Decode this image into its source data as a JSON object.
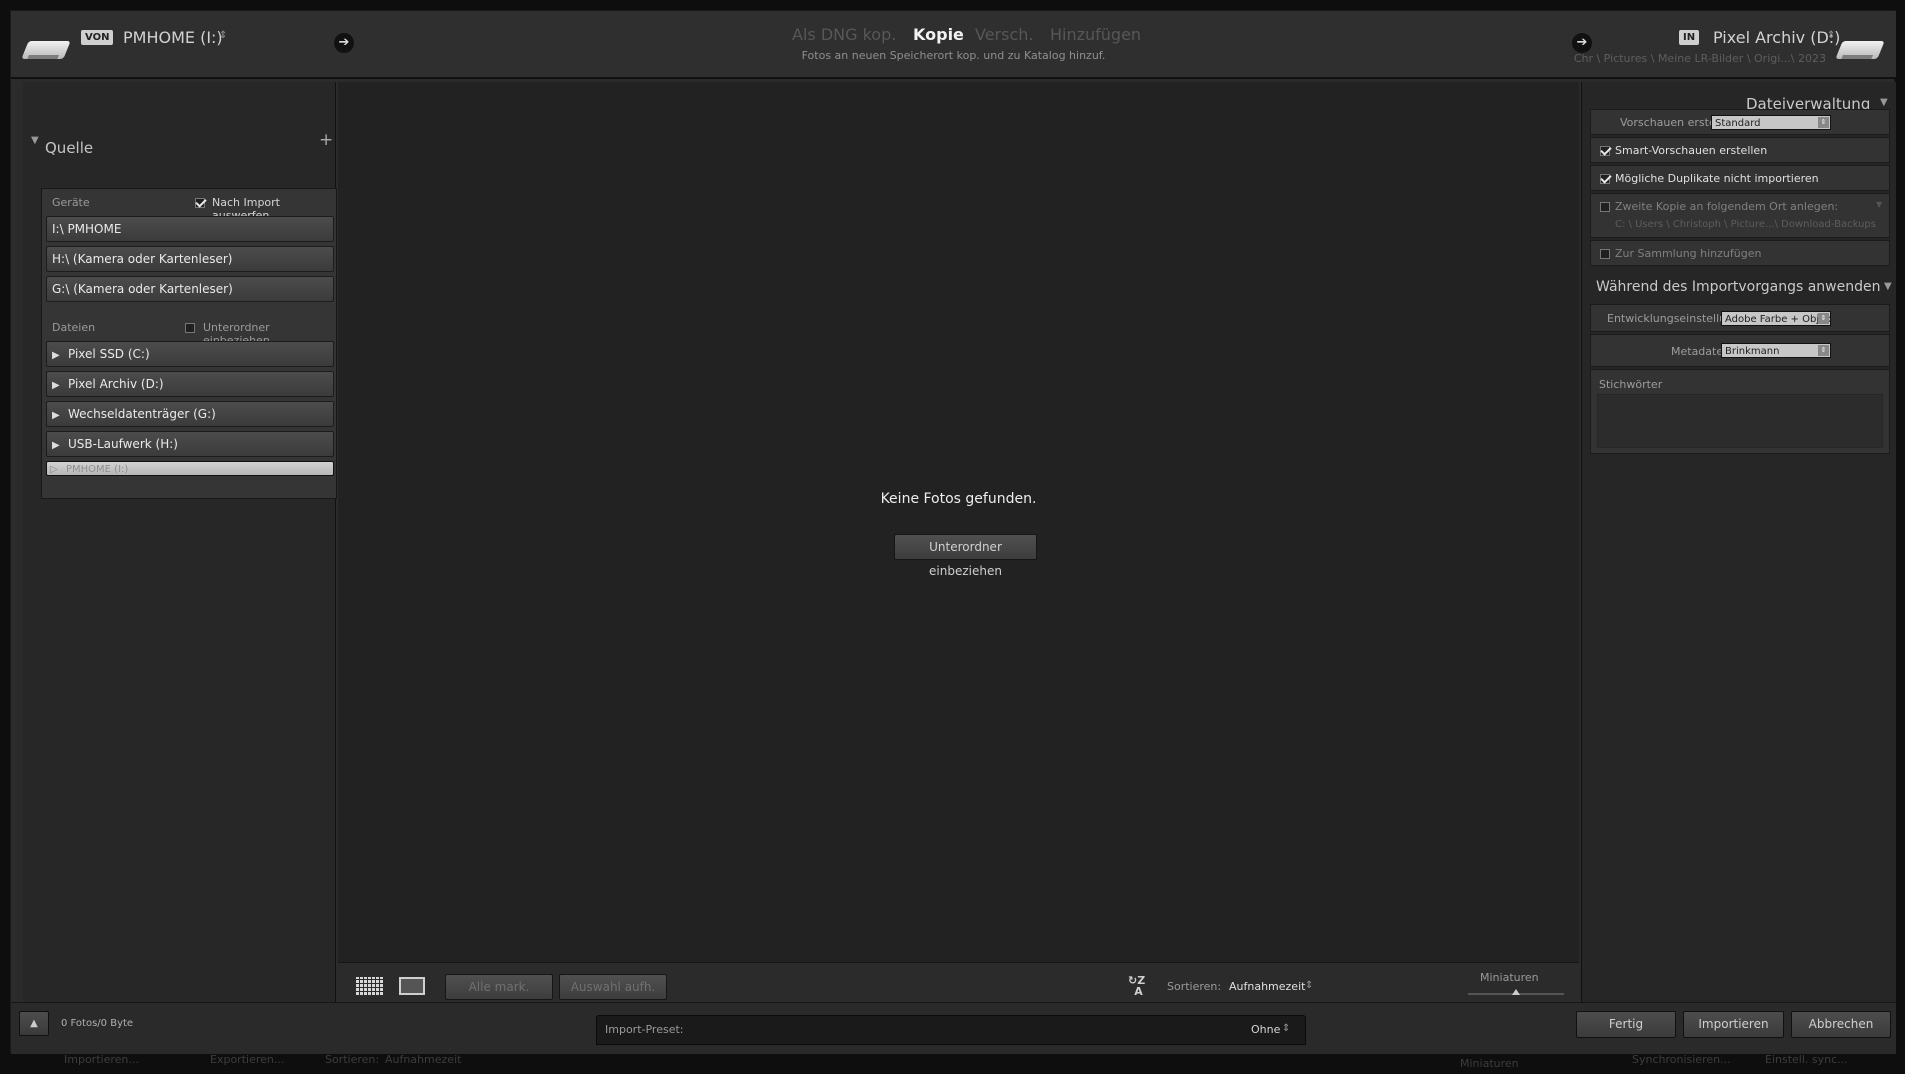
{
  "header": {
    "from_tag": "VON",
    "source_name": "PMHOME (I:)",
    "modes": [
      "Als DNG kop.",
      "Kopie",
      "Versch.",
      "Hinzufügen"
    ],
    "active_mode": "Kopie",
    "mode_description": "Fotos an neuen Speicherort kop. und zu Katalog hinzuf.",
    "to_tag": "IN",
    "dest_name": "Pixel Archiv (D:)",
    "dest_path": "Chr \\ Pictures \\ Meine LR-Bilder \\ Origi...\\ 2023"
  },
  "source": {
    "title": "Quelle",
    "devices_label": "Geräte",
    "eject_label": "Nach Import auswerfen",
    "eject_checked": true,
    "devices": [
      "I:\\ PMHOME",
      "H:\\ (Kamera oder Kartenleser)",
      "G:\\ (Kamera oder Kartenleser)"
    ],
    "files_label": "Dateien",
    "subfolder_label": "Unterordner einbeziehen",
    "subfolder_checked": false,
    "drives": [
      "Pixel SSD (C:)",
      "Pixel Archiv (D:)",
      "Wechseldatenträger (G:)",
      "USB-Laufwerk (H:)",
      "PMHOME (I:)"
    ],
    "selected_drive_index": 4
  },
  "center": {
    "empty_message": "Keine Fotos gefunden.",
    "include_subfolders_button": "Unterordner einbeziehen"
  },
  "toolbar": {
    "check_all": "Alle mark.",
    "uncheck_all": "Auswahl aufh.",
    "sort_label": "Sortieren:",
    "sort_value": "Aufnahmezeit",
    "thumb_label": "Miniaturen",
    "thumbnail_size": 0.5
  },
  "file_handling": {
    "title": "Dateiverwaltung",
    "preview_label": "Vorschauen erstellen",
    "preview_value": "Standard",
    "smart_previews": "Smart-Vorschauen erstellen",
    "smart_checked": true,
    "no_duplicates": "Mögliche Duplikate nicht importieren",
    "dup_checked": true,
    "second_copy": "Zweite Kopie an folgendem Ort anlegen:",
    "second_checked": false,
    "second_path": "C: \\ Users \\ Christoph \\ Picture...\\ Download-Backups",
    "add_collection": "Zur Sammlung hinzufügen",
    "coll_checked": false
  },
  "apply": {
    "title": "Während des Importvorgangs anwenden",
    "develop_label": "Entwicklungseinstellungen",
    "develop_value": "Adobe Farbe + Objek...",
    "metadata_label": "Metadaten",
    "metadata_value": "Brinkmann",
    "keywords_label": "Stichwörter"
  },
  "footer": {
    "count": "0 Fotos/0 Byte",
    "preset_label": "Import-Preset:",
    "preset_value": "Ohne",
    "done": "Fertig",
    "import": "Importieren",
    "cancel": "Abbrechen"
  },
  "behind": {
    "import": "Importieren...",
    "export": "Exportieren...",
    "sort_label": "Sortieren:",
    "sort_value": "Aufnahmezeit",
    "thumb_label": "Miniaturen",
    "sync_a": "Synchronisieren...",
    "sync_b": "Einstell. sync..."
  }
}
